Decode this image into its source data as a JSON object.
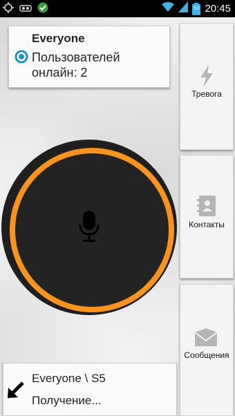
{
  "status_bar": {
    "time": "20:45",
    "battery_percent": "53",
    "icons": [
      "gps-icon",
      "voicemail-icon",
      "check-circle-icon",
      "wifi-icon",
      "signal-icon",
      "battery-icon"
    ]
  },
  "channel": {
    "name": "Everyone",
    "users_online": "Пользователей онлайн: 2"
  },
  "talk_button": {
    "icon": "microphone-icon",
    "ring_color": "#f7931e"
  },
  "side_buttons": [
    {
      "label": "Тревога",
      "icon": "lightning-icon"
    },
    {
      "label": "Контакты",
      "icon": "contacts-book-icon"
    },
    {
      "label": "Сообщения",
      "icon": "envelope-icon"
    }
  ],
  "status": {
    "channel_path": "Everyone \\ S5",
    "state": "Получение..."
  }
}
